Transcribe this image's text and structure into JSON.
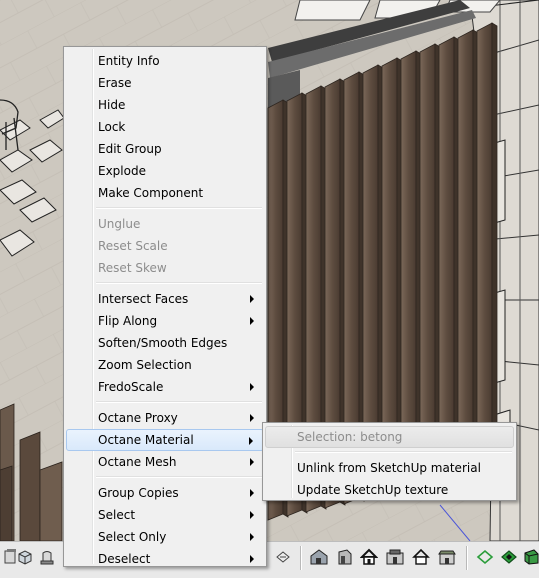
{
  "context_menu": {
    "groups": [
      [
        {
          "label": "Entity Info",
          "enabled": true,
          "submenu": false
        },
        {
          "label": "Erase",
          "enabled": true,
          "submenu": false
        },
        {
          "label": "Hide",
          "enabled": true,
          "submenu": false
        },
        {
          "label": "Lock",
          "enabled": true,
          "submenu": false
        },
        {
          "label": "Edit Group",
          "enabled": true,
          "submenu": false
        },
        {
          "label": "Explode",
          "enabled": true,
          "submenu": false
        },
        {
          "label": "Make Component",
          "enabled": true,
          "submenu": false
        }
      ],
      [
        {
          "label": "Unglue",
          "enabled": false,
          "submenu": false
        },
        {
          "label": "Reset Scale",
          "enabled": false,
          "submenu": false
        },
        {
          "label": "Reset Skew",
          "enabled": false,
          "submenu": false
        }
      ],
      [
        {
          "label": "Intersect Faces",
          "enabled": true,
          "submenu": true
        },
        {
          "label": "Flip Along",
          "enabled": true,
          "submenu": true
        },
        {
          "label": "Soften/Smooth Edges",
          "enabled": true,
          "submenu": false
        },
        {
          "label": "Zoom Selection",
          "enabled": true,
          "submenu": false
        },
        {
          "label": "FredoScale",
          "enabled": true,
          "submenu": true
        }
      ],
      [
        {
          "label": "Octane Proxy",
          "enabled": true,
          "submenu": true
        },
        {
          "label": "Octane Material",
          "enabled": true,
          "submenu": true,
          "highlighted": true
        },
        {
          "label": "Octane Mesh",
          "enabled": true,
          "submenu": true
        }
      ],
      [
        {
          "label": "Group Copies",
          "enabled": true,
          "submenu": true
        },
        {
          "label": "Select",
          "enabled": true,
          "submenu": true
        },
        {
          "label": "Select Only",
          "enabled": true,
          "submenu": true
        },
        {
          "label": "Deselect",
          "enabled": true,
          "submenu": true
        }
      ]
    ]
  },
  "submenu": {
    "groups": [
      [
        {
          "label": "Selection: betong",
          "enabled": false,
          "highlighted": true
        }
      ],
      [
        {
          "label": "Unlink from SketchUp material",
          "enabled": true
        },
        {
          "label": "Update SketchUp texture",
          "enabled": true
        }
      ]
    ]
  },
  "toolbar": {
    "icons": [
      "paint-bucket-icon",
      "component-icon",
      "group-icon",
      "select-icon",
      "front-view-icon",
      "right-view-icon",
      "house-icon",
      "back-view-icon",
      "left-view-icon",
      "roof-view-icon",
      "section-plane-icon",
      "section-display-icon",
      "section-cut-icon"
    ]
  },
  "colors": {
    "highlight_border": "#a8c8ef",
    "disabled_text": "#8d8d8d",
    "wood_dark": "#5b4a3d",
    "wood_light": "#8a7766"
  }
}
